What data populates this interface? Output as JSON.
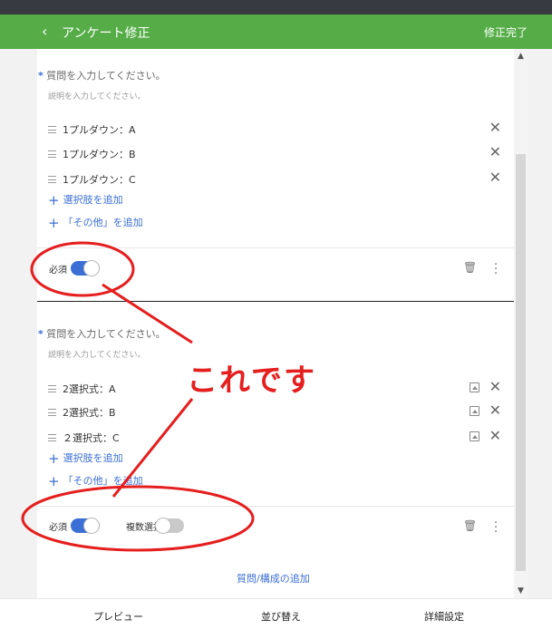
{
  "header": {
    "back_icon": "‹",
    "title": "アンケート修正",
    "done": "修正完了"
  },
  "q1": {
    "star": "*",
    "question": "質問を入力してください。",
    "description": "説明を入力してください。",
    "options": [
      "1プルダウン：A",
      "1プルダウン：B",
      "1プルダウン：C"
    ],
    "add_option": "選択肢を追加",
    "add_other": "「その他」を追加",
    "required_label": "必須"
  },
  "q2": {
    "star": "*",
    "question": "質問を入力してください。",
    "description": "説明を入力してください。",
    "options": [
      "2選択式：A",
      "2選択式：B",
      "２選択式：C"
    ],
    "add_option": "選択肢を追加",
    "add_other": "「その他」を追加",
    "required_label": "必須",
    "multi_label": "複数選択"
  },
  "add_question": "質問/構成の追加",
  "bottom": {
    "preview": "プレビュー",
    "sort": "並び替え",
    "detail": "詳細設定"
  },
  "annotation": {
    "text": "これです",
    "color": "#e51e1e"
  },
  "colors": {
    "header": "#56ad48",
    "accent": "#3b6fd6"
  }
}
